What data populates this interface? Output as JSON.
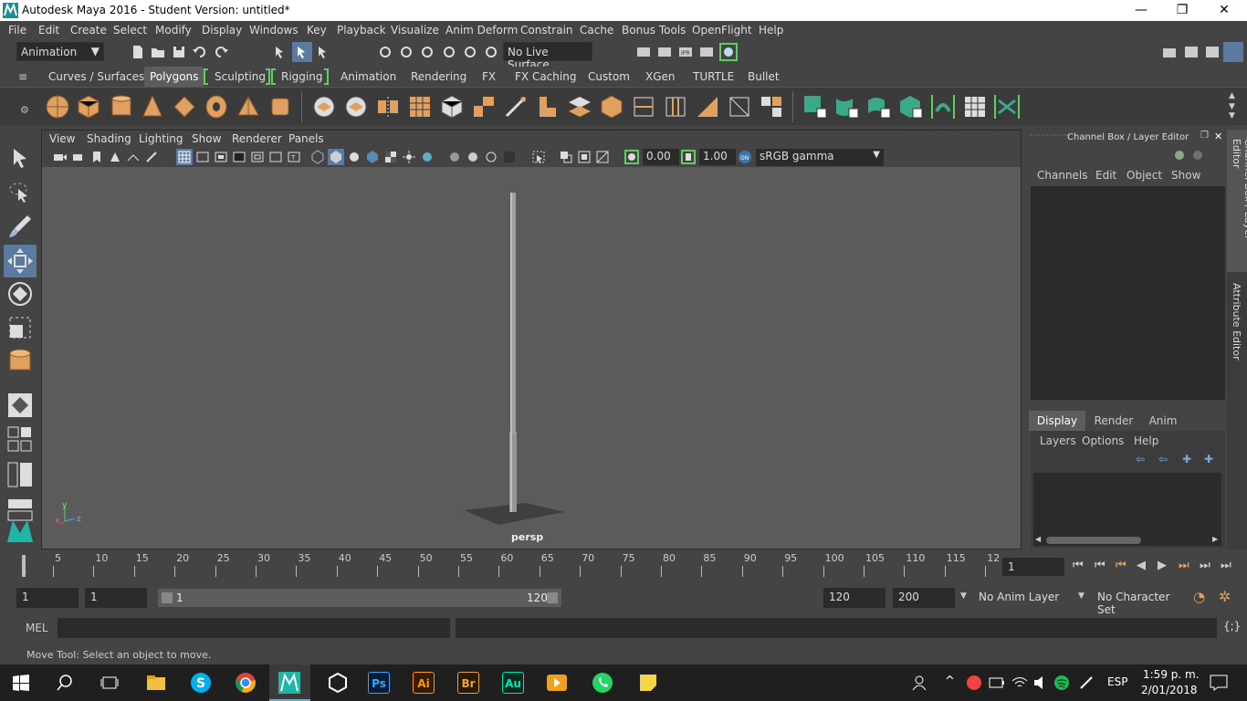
{
  "window": {
    "title": "Autodesk Maya 2016 - Student Version: untitled*",
    "minimize": "—",
    "restore": "❐",
    "close": "✕"
  },
  "menu": [
    "File",
    "Edit",
    "Create",
    "Select",
    "Modify",
    "Display",
    "Windows",
    "Key",
    "Playback",
    "Visualize",
    "Anim Deform",
    "Constrain",
    "Cache",
    "Bonus Tools",
    "OpenFlight",
    "Help"
  ],
  "statusline": {
    "menuset": "Animation",
    "live_surface": "No Live Surface"
  },
  "shelf_tabs": [
    "Curves / Surfaces",
    "Polygons",
    "Sculpting",
    "Rigging",
    "Animation",
    "Rendering",
    "FX",
    "FX Caching",
    "Custom",
    "XGen",
    "TURTLE",
    "Bullet"
  ],
  "shelf_active": "Polygons",
  "panel": {
    "menus": [
      "View",
      "Shading",
      "Lighting",
      "Show",
      "Renderer",
      "Panels"
    ],
    "exposure": "0.00",
    "gamma": "1.00",
    "color_space": "sRGB gamma",
    "camera": "persp",
    "axis_y": "y",
    "axis_x": "x",
    "axis_z": "z"
  },
  "channel_box": {
    "title": "Channel Box / Layer Editor",
    "menus": [
      "Channels",
      "Edit",
      "Object",
      "Show"
    ],
    "layer_tabs": [
      "Display",
      "Render",
      "Anim"
    ],
    "layer_active": "Display",
    "layer_menus": [
      "Layers",
      "Options",
      "Help"
    ]
  },
  "side_tabs": {
    "channel": "Channel Box / Layer Editor",
    "attribute": "Attribute Editor"
  },
  "timeline": {
    "ticks": [
      "5",
      "10",
      "15",
      "20",
      "25",
      "30",
      "35",
      "40",
      "45",
      "50",
      "55",
      "60",
      "65",
      "70",
      "75",
      "80",
      "85",
      "90",
      "95",
      "100",
      "105",
      "110",
      "115",
      "12"
    ],
    "current_marker": "1",
    "current_frame": "1"
  },
  "range": {
    "start": "1",
    "playback_start": "1",
    "slider_start": "1",
    "slider_end": "120",
    "playback_end": "120",
    "end": "200",
    "anim_layer": "No Anim Layer",
    "character_set": "No Character Set"
  },
  "cmdline": {
    "lang": "MEL"
  },
  "helpline": {
    "text": "Move Tool: Select an object to move."
  },
  "taskbar": {
    "time": "1:59 p. m.",
    "date": "2/01/2018",
    "lang": "ESP",
    "apps": [
      "Ps",
      "Ai",
      "Br",
      "Au"
    ]
  },
  "colors": {
    "accent_green": "#5fcf5f",
    "poly_orange": "#e0a060",
    "viewport_bg": "#5b5b5b",
    "maya_teal": "#1fb5a8"
  }
}
